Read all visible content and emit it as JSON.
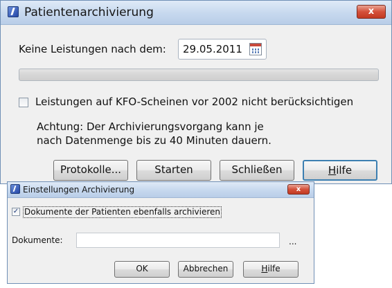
{
  "main_window": {
    "title": "Patientenarchivierung",
    "close_glyph": "x",
    "date_label": "Keine Leistungen nach dem:",
    "date_value": "29.05.2011",
    "calendar_icon": "calendar-icon",
    "checkbox_label": "Leistungen auf KFO-Scheinen vor 2002 nicht berücksichtigen",
    "checkbox_checked": false,
    "warning_line1": "Achtung: Der Archivierungsvorgang kann je",
    "warning_line2": "nach Datenmenge bis zu 40 Minuten dauern.",
    "buttons": {
      "protokolle": "Protokolle...",
      "starten": "Starten",
      "schliessen": "Schließen",
      "hilfe_access": "H",
      "hilfe_rest": "ilfe"
    }
  },
  "settings_dialog": {
    "title": "Einstellungen Archivierung",
    "close_glyph": "x",
    "checkbox_label": "Dokumente der Patienten ebenfalls archivieren",
    "checkbox_checked": true,
    "checkmark": "✓",
    "doc_label": "Dokumente:",
    "doc_value": "",
    "browse_label": "...",
    "buttons": {
      "ok": "OK",
      "abbrechen": "Abbrechen",
      "hilfe_access": "H",
      "hilfe_rest": "ilfe"
    }
  },
  "colors": {
    "title_gradient": "#c6d8ee",
    "close_red": "#d4503a",
    "default_button_border": "#3c7fb1"
  }
}
